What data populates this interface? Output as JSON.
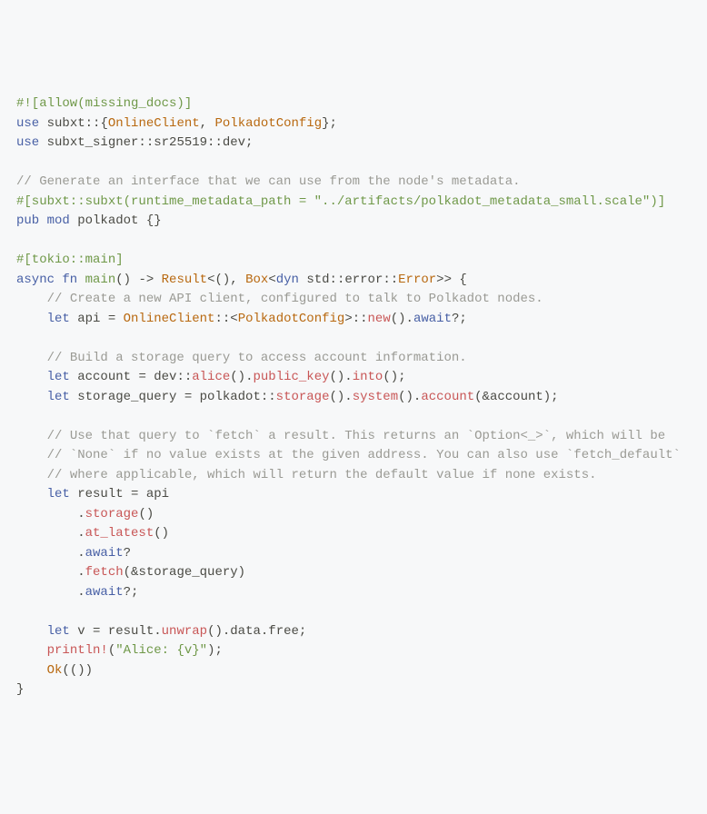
{
  "lines": [
    [
      {
        "cls": "c-pragma",
        "t": "#![allow(missing_docs)]"
      }
    ],
    [
      {
        "cls": "c-kw",
        "t": "use"
      },
      {
        "cls": "c-ns",
        "t": " subxt::"
      },
      {
        "cls": "c-punc",
        "t": "{"
      },
      {
        "cls": "c-type",
        "t": "OnlineClient"
      },
      {
        "cls": "c-punc",
        "t": ", "
      },
      {
        "cls": "c-type",
        "t": "PolkadotConfig"
      },
      {
        "cls": "c-punc",
        "t": "};"
      }
    ],
    [
      {
        "cls": "c-kw",
        "t": "use"
      },
      {
        "cls": "c-ns",
        "t": " subxt_signer::sr25519::dev;"
      }
    ],
    [
      {
        "cls": "",
        "t": ""
      }
    ],
    [
      {
        "cls": "c-comment",
        "t": "// Generate an interface that we can use from the node's metadata."
      }
    ],
    [
      {
        "cls": "c-pragma",
        "t": "#[subxt::subxt(runtime_metadata_path = \"../artifacts/polkadot_metadata_small.scale\")]"
      }
    ],
    [
      {
        "cls": "c-kw",
        "t": "pub mod"
      },
      {
        "cls": "c-mod-name",
        "t": " polkadot "
      },
      {
        "cls": "c-punc",
        "t": "{}"
      }
    ],
    [
      {
        "cls": "",
        "t": ""
      }
    ],
    [
      {
        "cls": "c-pragma",
        "t": "#[tokio::main]"
      }
    ],
    [
      {
        "cls": "c-kw",
        "t": "async fn"
      },
      {
        "cls": "c-fn-name",
        "t": " main"
      },
      {
        "cls": "c-punc",
        "t": "() -> "
      },
      {
        "cls": "c-type",
        "t": "Result"
      },
      {
        "cls": "c-punc",
        "t": "<(), "
      },
      {
        "cls": "c-type",
        "t": "Box"
      },
      {
        "cls": "c-punc",
        "t": "<"
      },
      {
        "cls": "c-kw",
        "t": "dyn"
      },
      {
        "cls": "c-ns",
        "t": " std::error::"
      },
      {
        "cls": "c-type",
        "t": "Error"
      },
      {
        "cls": "c-punc",
        "t": ">> {"
      }
    ],
    [
      {
        "cls": "c-ident",
        "t": "    "
      },
      {
        "cls": "c-comment",
        "t": "// Create a new API client, configured to talk to Polkadot nodes."
      }
    ],
    [
      {
        "cls": "c-ident",
        "t": "    "
      },
      {
        "cls": "c-kw",
        "t": "let"
      },
      {
        "cls": "c-ident",
        "t": " api = "
      },
      {
        "cls": "c-type",
        "t": "OnlineClient"
      },
      {
        "cls": "c-punc",
        "t": "::<"
      },
      {
        "cls": "c-type",
        "t": "PolkadotConfig"
      },
      {
        "cls": "c-punc",
        "t": ">::"
      },
      {
        "cls": "c-call",
        "t": "new"
      },
      {
        "cls": "c-punc",
        "t": "()."
      },
      {
        "cls": "c-kw",
        "t": "await"
      },
      {
        "cls": "c-punc",
        "t": "?;"
      }
    ],
    [
      {
        "cls": "",
        "t": ""
      }
    ],
    [
      {
        "cls": "c-ident",
        "t": "    "
      },
      {
        "cls": "c-comment",
        "t": "// Build a storage query to access account information."
      }
    ],
    [
      {
        "cls": "c-ident",
        "t": "    "
      },
      {
        "cls": "c-kw",
        "t": "let"
      },
      {
        "cls": "c-ident",
        "t": " account = dev::"
      },
      {
        "cls": "c-call",
        "t": "alice"
      },
      {
        "cls": "c-punc",
        "t": "()."
      },
      {
        "cls": "c-call",
        "t": "public_key"
      },
      {
        "cls": "c-punc",
        "t": "()."
      },
      {
        "cls": "c-call",
        "t": "into"
      },
      {
        "cls": "c-punc",
        "t": "();"
      }
    ],
    [
      {
        "cls": "c-ident",
        "t": "    "
      },
      {
        "cls": "c-kw",
        "t": "let"
      },
      {
        "cls": "c-ident",
        "t": " storage_query = polkadot::"
      },
      {
        "cls": "c-call",
        "t": "storage"
      },
      {
        "cls": "c-punc",
        "t": "()."
      },
      {
        "cls": "c-call",
        "t": "system"
      },
      {
        "cls": "c-punc",
        "t": "()."
      },
      {
        "cls": "c-call",
        "t": "account"
      },
      {
        "cls": "c-punc",
        "t": "(&account);"
      }
    ],
    [
      {
        "cls": "",
        "t": ""
      }
    ],
    [
      {
        "cls": "c-ident",
        "t": "    "
      },
      {
        "cls": "c-comment",
        "t": "// Use that query to `fetch` a result. This returns an `Option<_>`, which will be"
      }
    ],
    [
      {
        "cls": "c-ident",
        "t": "    "
      },
      {
        "cls": "c-comment",
        "t": "// `None` if no value exists at the given address. You can also use `fetch_default`"
      }
    ],
    [
      {
        "cls": "c-ident",
        "t": "    "
      },
      {
        "cls": "c-comment",
        "t": "// where applicable, which will return the default value if none exists."
      }
    ],
    [
      {
        "cls": "c-ident",
        "t": "    "
      },
      {
        "cls": "c-kw",
        "t": "let"
      },
      {
        "cls": "c-ident",
        "t": " result = api"
      }
    ],
    [
      {
        "cls": "c-ident",
        "t": "        ."
      },
      {
        "cls": "c-call",
        "t": "storage"
      },
      {
        "cls": "c-punc",
        "t": "()"
      }
    ],
    [
      {
        "cls": "c-ident",
        "t": "        ."
      },
      {
        "cls": "c-call",
        "t": "at_latest"
      },
      {
        "cls": "c-punc",
        "t": "()"
      }
    ],
    [
      {
        "cls": "c-ident",
        "t": "        ."
      },
      {
        "cls": "c-kw",
        "t": "await"
      },
      {
        "cls": "c-punc",
        "t": "?"
      }
    ],
    [
      {
        "cls": "c-ident",
        "t": "        ."
      },
      {
        "cls": "c-call",
        "t": "fetch"
      },
      {
        "cls": "c-punc",
        "t": "(&storage_query)"
      }
    ],
    [
      {
        "cls": "c-ident",
        "t": "        ."
      },
      {
        "cls": "c-kw",
        "t": "await"
      },
      {
        "cls": "c-punc",
        "t": "?;"
      }
    ],
    [
      {
        "cls": "",
        "t": ""
      }
    ],
    [
      {
        "cls": "c-ident",
        "t": "    "
      },
      {
        "cls": "c-kw",
        "t": "let"
      },
      {
        "cls": "c-ident",
        "t": " v = result."
      },
      {
        "cls": "c-call",
        "t": "unwrap"
      },
      {
        "cls": "c-punc",
        "t": "().data.free;"
      }
    ],
    [
      {
        "cls": "c-ident",
        "t": "    "
      },
      {
        "cls": "c-call",
        "t": "println!"
      },
      {
        "cls": "c-punc",
        "t": "("
      },
      {
        "cls": "c-str",
        "t": "\"Alice: {v}\""
      },
      {
        "cls": "c-punc",
        "t": ");"
      }
    ],
    [
      {
        "cls": "c-ident",
        "t": "    "
      },
      {
        "cls": "c-type",
        "t": "Ok"
      },
      {
        "cls": "c-punc",
        "t": "(())"
      }
    ],
    [
      {
        "cls": "c-punc",
        "t": "}"
      }
    ]
  ]
}
